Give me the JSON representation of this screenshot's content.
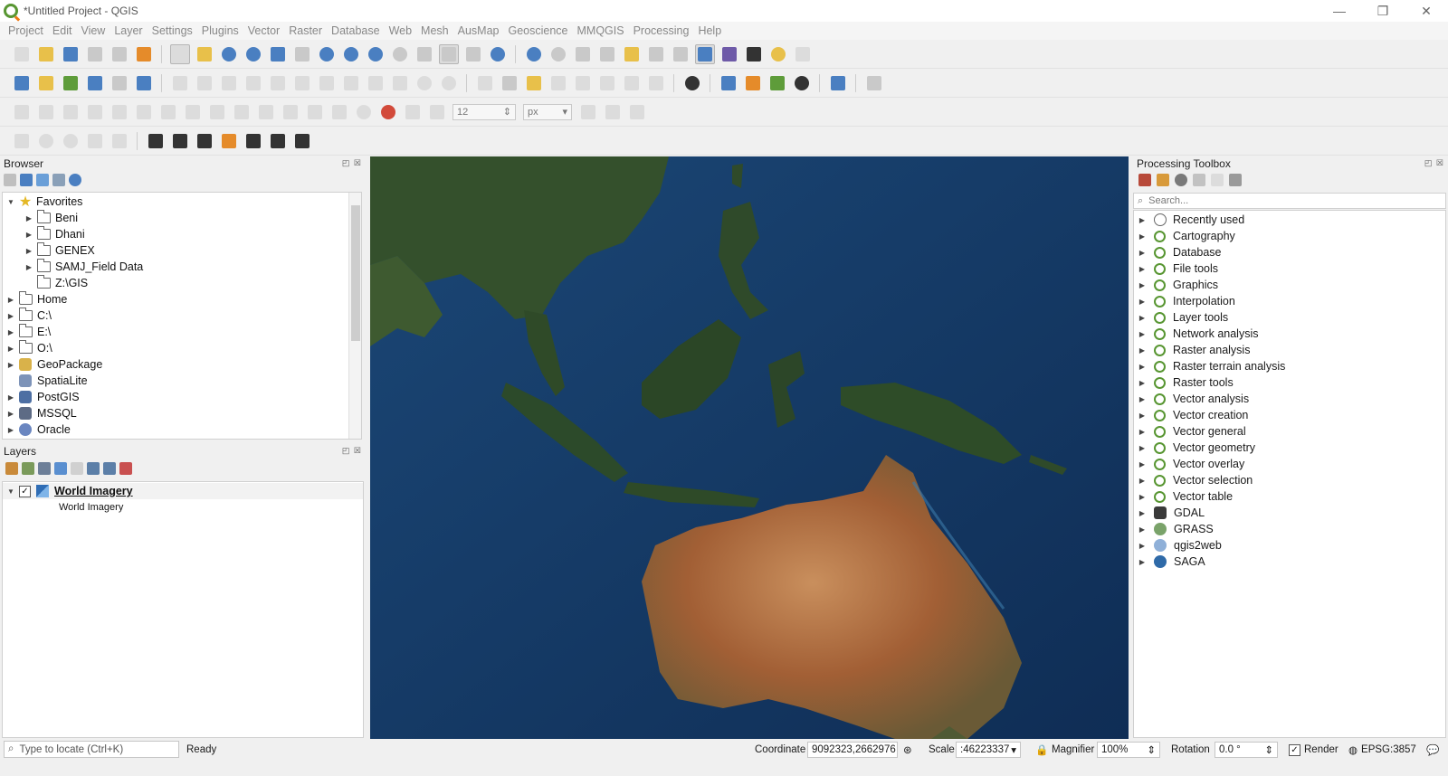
{
  "window": {
    "title": "*Untitled Project - QGIS",
    "minimize": "—",
    "restore": "❐",
    "close": "✕"
  },
  "menu": [
    "Project",
    "Edit",
    "View",
    "Layer",
    "Settings",
    "Plugins",
    "Vector",
    "Raster",
    "Database",
    "Web",
    "Mesh",
    "AusMap",
    "Geoscience",
    "MMQGIS",
    "Processing",
    "Help"
  ],
  "toolbar3": {
    "size_value": "12",
    "unit_value": "px"
  },
  "browser": {
    "title": "Browser",
    "items": [
      {
        "label": "Favorites",
        "level": 0,
        "expanded": true,
        "icon": "star-icon"
      },
      {
        "label": "Beni",
        "level": 1,
        "expanded": false,
        "icon": "folder-icon"
      },
      {
        "label": "Dhani",
        "level": 1,
        "expanded": false,
        "icon": "folder-icon"
      },
      {
        "label": "GENEX",
        "level": 1,
        "expanded": false,
        "icon": "folder-icon"
      },
      {
        "label": "SAMJ_Field Data",
        "level": 1,
        "expanded": false,
        "icon": "folder-icon"
      },
      {
        "label": "Z:\\GIS",
        "level": 1,
        "expanded": null,
        "icon": "folder-icon"
      },
      {
        "label": "Home",
        "level": 0,
        "expanded": false,
        "icon": "home-folder-icon"
      },
      {
        "label": "C:\\",
        "level": 0,
        "expanded": false,
        "icon": "drive-icon"
      },
      {
        "label": "E:\\",
        "level": 0,
        "expanded": false,
        "icon": "drive-icon"
      },
      {
        "label": "O:\\",
        "level": 0,
        "expanded": false,
        "icon": "drive-icon"
      },
      {
        "label": "GeoPackage",
        "level": 0,
        "expanded": false,
        "icon": "geopackage-icon"
      },
      {
        "label": "SpatiaLite",
        "level": 0,
        "expanded": null,
        "icon": "spatialite-icon"
      },
      {
        "label": "PostGIS",
        "level": 0,
        "expanded": false,
        "icon": "postgis-icon"
      },
      {
        "label": "MSSQL",
        "level": 0,
        "expanded": false,
        "icon": "mssql-icon"
      },
      {
        "label": "Oracle",
        "level": 0,
        "expanded": false,
        "icon": "oracle-icon"
      }
    ]
  },
  "layers": {
    "title": "Layers",
    "layer_name": "World Imagery",
    "layer_sub": "World Imagery",
    "checked": true
  },
  "processing": {
    "title": "Processing Toolbox",
    "search_placeholder": "Search...",
    "items": [
      {
        "label": "Recently used",
        "icon": "clock-icon"
      },
      {
        "label": "Cartography",
        "icon": "qgis-icon"
      },
      {
        "label": "Database",
        "icon": "qgis-icon"
      },
      {
        "label": "File tools",
        "icon": "qgis-icon"
      },
      {
        "label": "Graphics",
        "icon": "qgis-icon"
      },
      {
        "label": "Interpolation",
        "icon": "qgis-icon"
      },
      {
        "label": "Layer tools",
        "icon": "qgis-icon"
      },
      {
        "label": "Network analysis",
        "icon": "qgis-icon"
      },
      {
        "label": "Raster analysis",
        "icon": "qgis-icon"
      },
      {
        "label": "Raster terrain analysis",
        "icon": "qgis-icon"
      },
      {
        "label": "Raster tools",
        "icon": "qgis-icon"
      },
      {
        "label": "Vector analysis",
        "icon": "qgis-icon"
      },
      {
        "label": "Vector creation",
        "icon": "qgis-icon"
      },
      {
        "label": "Vector general",
        "icon": "qgis-icon"
      },
      {
        "label": "Vector geometry",
        "icon": "qgis-icon"
      },
      {
        "label": "Vector overlay",
        "icon": "qgis-icon"
      },
      {
        "label": "Vector selection",
        "icon": "qgis-icon"
      },
      {
        "label": "Vector table",
        "icon": "qgis-icon"
      },
      {
        "label": "GDAL",
        "icon": "gdal-icon"
      },
      {
        "label": "GRASS",
        "icon": "grass-icon"
      },
      {
        "label": "qgis2web",
        "icon": "qgis2web-icon"
      },
      {
        "label": "SAGA",
        "icon": "saga-icon"
      }
    ]
  },
  "status": {
    "locator_placeholder": "Type to locate (Ctrl+K)",
    "ready": "Ready",
    "coordinate_label": "Coordinate",
    "coordinate_value": "9092323,2662976",
    "scale_label": "Scale",
    "scale_value": ":46223337",
    "magnifier_label": "Magnifier",
    "magnifier_value": "100%",
    "rotation_label": "Rotation",
    "rotation_value": "0.0 °",
    "render_label": "Render",
    "crs": "EPSG:3857"
  },
  "colors": {
    "qgis_green": "#589632",
    "qgis_orange": "#ee7913",
    "ocean": "#13365f",
    "land": "#2e4a2a",
    "desert": "#b06a3a"
  }
}
